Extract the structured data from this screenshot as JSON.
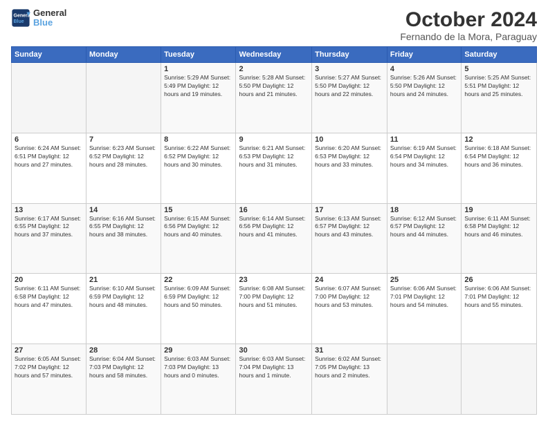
{
  "logo": {
    "line1": "General",
    "line2": "Blue"
  },
  "title": "October 2024",
  "location": "Fernando de la Mora, Paraguay",
  "days_header": [
    "Sunday",
    "Monday",
    "Tuesday",
    "Wednesday",
    "Thursday",
    "Friday",
    "Saturday"
  ],
  "weeks": [
    [
      {
        "day": "",
        "info": ""
      },
      {
        "day": "",
        "info": ""
      },
      {
        "day": "1",
        "info": "Sunrise: 5:29 AM\nSunset: 5:49 PM\nDaylight: 12 hours\nand 19 minutes."
      },
      {
        "day": "2",
        "info": "Sunrise: 5:28 AM\nSunset: 5:50 PM\nDaylight: 12 hours\nand 21 minutes."
      },
      {
        "day": "3",
        "info": "Sunrise: 5:27 AM\nSunset: 5:50 PM\nDaylight: 12 hours\nand 22 minutes."
      },
      {
        "day": "4",
        "info": "Sunrise: 5:26 AM\nSunset: 5:50 PM\nDaylight: 12 hours\nand 24 minutes."
      },
      {
        "day": "5",
        "info": "Sunrise: 5:25 AM\nSunset: 5:51 PM\nDaylight: 12 hours\nand 25 minutes."
      }
    ],
    [
      {
        "day": "6",
        "info": "Sunrise: 6:24 AM\nSunset: 6:51 PM\nDaylight: 12 hours\nand 27 minutes."
      },
      {
        "day": "7",
        "info": "Sunrise: 6:23 AM\nSunset: 6:52 PM\nDaylight: 12 hours\nand 28 minutes."
      },
      {
        "day": "8",
        "info": "Sunrise: 6:22 AM\nSunset: 6:52 PM\nDaylight: 12 hours\nand 30 minutes."
      },
      {
        "day": "9",
        "info": "Sunrise: 6:21 AM\nSunset: 6:53 PM\nDaylight: 12 hours\nand 31 minutes."
      },
      {
        "day": "10",
        "info": "Sunrise: 6:20 AM\nSunset: 6:53 PM\nDaylight: 12 hours\nand 33 minutes."
      },
      {
        "day": "11",
        "info": "Sunrise: 6:19 AM\nSunset: 6:54 PM\nDaylight: 12 hours\nand 34 minutes."
      },
      {
        "day": "12",
        "info": "Sunrise: 6:18 AM\nSunset: 6:54 PM\nDaylight: 12 hours\nand 36 minutes."
      }
    ],
    [
      {
        "day": "13",
        "info": "Sunrise: 6:17 AM\nSunset: 6:55 PM\nDaylight: 12 hours\nand 37 minutes."
      },
      {
        "day": "14",
        "info": "Sunrise: 6:16 AM\nSunset: 6:55 PM\nDaylight: 12 hours\nand 38 minutes."
      },
      {
        "day": "15",
        "info": "Sunrise: 6:15 AM\nSunset: 6:56 PM\nDaylight: 12 hours\nand 40 minutes."
      },
      {
        "day": "16",
        "info": "Sunrise: 6:14 AM\nSunset: 6:56 PM\nDaylight: 12 hours\nand 41 minutes."
      },
      {
        "day": "17",
        "info": "Sunrise: 6:13 AM\nSunset: 6:57 PM\nDaylight: 12 hours\nand 43 minutes."
      },
      {
        "day": "18",
        "info": "Sunrise: 6:12 AM\nSunset: 6:57 PM\nDaylight: 12 hours\nand 44 minutes."
      },
      {
        "day": "19",
        "info": "Sunrise: 6:11 AM\nSunset: 6:58 PM\nDaylight: 12 hours\nand 46 minutes."
      }
    ],
    [
      {
        "day": "20",
        "info": "Sunrise: 6:11 AM\nSunset: 6:58 PM\nDaylight: 12 hours\nand 47 minutes."
      },
      {
        "day": "21",
        "info": "Sunrise: 6:10 AM\nSunset: 6:59 PM\nDaylight: 12 hours\nand 48 minutes."
      },
      {
        "day": "22",
        "info": "Sunrise: 6:09 AM\nSunset: 6:59 PM\nDaylight: 12 hours\nand 50 minutes."
      },
      {
        "day": "23",
        "info": "Sunrise: 6:08 AM\nSunset: 7:00 PM\nDaylight: 12 hours\nand 51 minutes."
      },
      {
        "day": "24",
        "info": "Sunrise: 6:07 AM\nSunset: 7:00 PM\nDaylight: 12 hours\nand 53 minutes."
      },
      {
        "day": "25",
        "info": "Sunrise: 6:06 AM\nSunset: 7:01 PM\nDaylight: 12 hours\nand 54 minutes."
      },
      {
        "day": "26",
        "info": "Sunrise: 6:06 AM\nSunset: 7:01 PM\nDaylight: 12 hours\nand 55 minutes."
      }
    ],
    [
      {
        "day": "27",
        "info": "Sunrise: 6:05 AM\nSunset: 7:02 PM\nDaylight: 12 hours\nand 57 minutes."
      },
      {
        "day": "28",
        "info": "Sunrise: 6:04 AM\nSunset: 7:03 PM\nDaylight: 12 hours\nand 58 minutes."
      },
      {
        "day": "29",
        "info": "Sunrise: 6:03 AM\nSunset: 7:03 PM\nDaylight: 13 hours\nand 0 minutes."
      },
      {
        "day": "30",
        "info": "Sunrise: 6:03 AM\nSunset: 7:04 PM\nDaylight: 13 hours\nand 1 minute."
      },
      {
        "day": "31",
        "info": "Sunrise: 6:02 AM\nSunset: 7:05 PM\nDaylight: 13 hours\nand 2 minutes."
      },
      {
        "day": "",
        "info": ""
      },
      {
        "day": "",
        "info": ""
      }
    ]
  ]
}
